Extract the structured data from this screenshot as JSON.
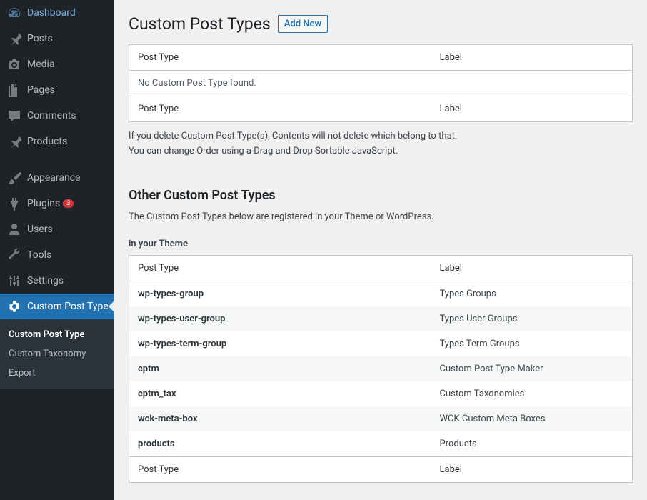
{
  "sidebar": {
    "items": [
      {
        "label": "Dashboard",
        "icon": "dashboard"
      },
      {
        "label": "Posts",
        "icon": "pin"
      },
      {
        "label": "Media",
        "icon": "media"
      },
      {
        "label": "Pages",
        "icon": "pages"
      },
      {
        "label": "Comments",
        "icon": "comments"
      },
      {
        "label": "Products",
        "icon": "pin"
      },
      {
        "label": "Appearance",
        "icon": "brush"
      },
      {
        "label": "Plugins",
        "icon": "plugin",
        "badge": "3"
      },
      {
        "label": "Users",
        "icon": "users"
      },
      {
        "label": "Tools",
        "icon": "tools"
      },
      {
        "label": "Settings",
        "icon": "settings"
      },
      {
        "label": "Custom Post Type",
        "icon": "gear",
        "current": true
      }
    ],
    "submenu": [
      {
        "label": "Custom Post Type",
        "active": true
      },
      {
        "label": "Custom Taxonomy"
      },
      {
        "label": "Export"
      }
    ]
  },
  "header": {
    "title": "Custom Post Types",
    "add_new": "Add New"
  },
  "table1": {
    "col1": "Post Type",
    "col2": "Label",
    "empty_msg": "No Custom Post Type found."
  },
  "notes": {
    "line1": "If you delete Custom Post Type(s), Contents will not delete which belong to that.",
    "line2": "You can change Order using a Drag and Drop Sortable JavaScript."
  },
  "section2": {
    "title": "Other Custom Post Types",
    "desc": "The Custom Post Types below are registered in your Theme or WordPress.",
    "sub_label": "in your Theme",
    "col1": "Post Type",
    "col2": "Label",
    "rows": [
      {
        "slug": "wp-types-group",
        "label": "Types Groups"
      },
      {
        "slug": "wp-types-user-group",
        "label": "Types User Groups"
      },
      {
        "slug": "wp-types-term-group",
        "label": "Types Term Groups"
      },
      {
        "slug": "cptm",
        "label": "Custom Post Type Maker"
      },
      {
        "slug": "cptm_tax",
        "label": "Custom Taxonomies"
      },
      {
        "slug": "wck-meta-box",
        "label": "WCK Custom Meta Boxes"
      },
      {
        "slug": "products",
        "label": "Products"
      }
    ]
  }
}
